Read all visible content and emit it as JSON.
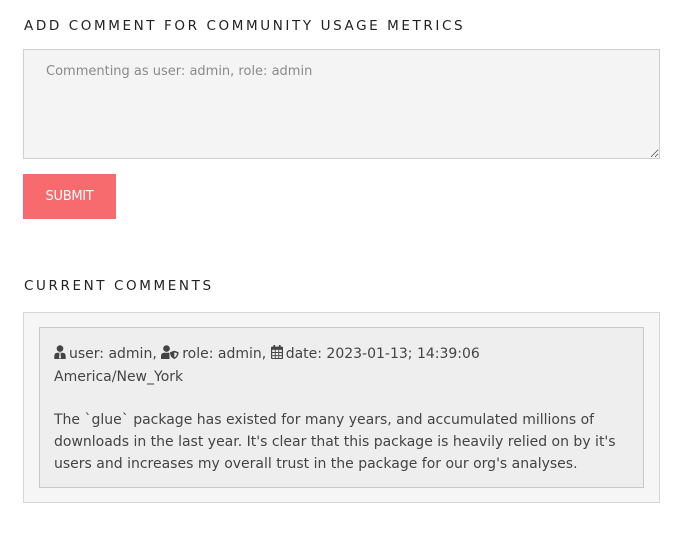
{
  "add_section": {
    "title": "ADD COMMENT FOR COMMUNITY USAGE METRICS",
    "textarea_placeholder": "Commenting as user: admin, role: admin",
    "textarea_value": "",
    "submit_label": "SUBMIT"
  },
  "current_section": {
    "title": "CURRENT COMMENTS",
    "comments": [
      {
        "user": "user: admin,",
        "role": "role: admin,",
        "date": "date: 2023-01-13; 14:39:06",
        "timezone": "America/New_York",
        "body": "The `glue` package has existed for many years, and accumulated millions of downloads in the last year. It's clear that this package is heavily relied on by it's users and increases my overall trust in the package for our org's analyses."
      }
    ]
  },
  "icons": {
    "user": "user-icon",
    "role": "user-shield-icon",
    "date": "calendar-icon"
  },
  "colors": {
    "submit_button": "#f76b6e",
    "textarea_background": "#f4f4f5",
    "comment_card_background": "#eeeeee"
  }
}
